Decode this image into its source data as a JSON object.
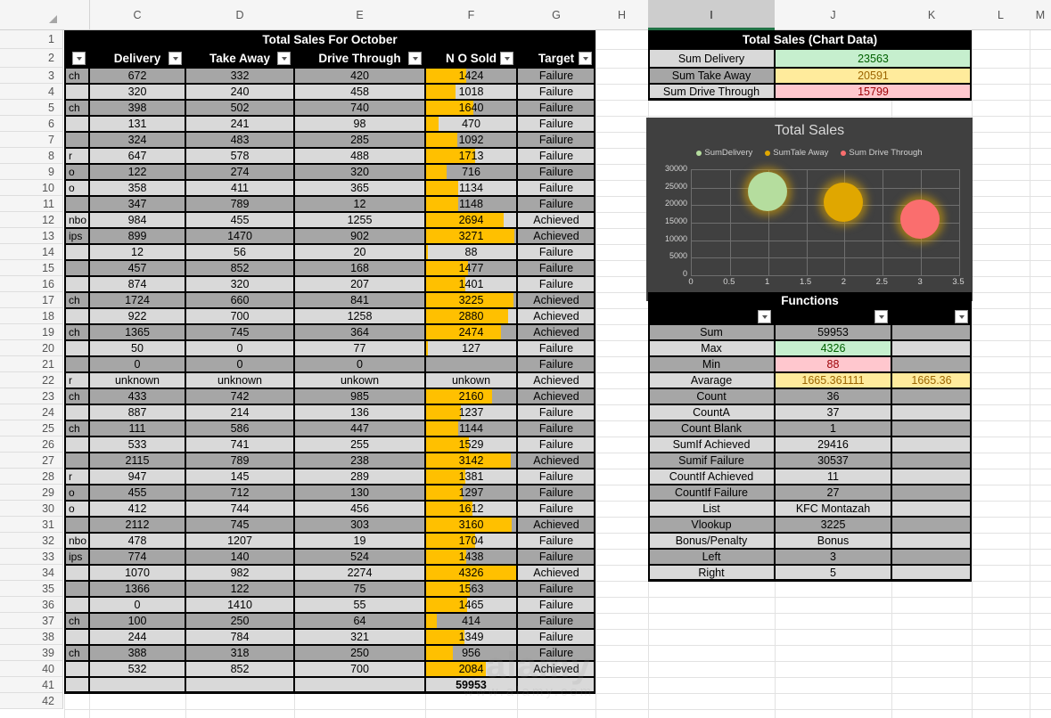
{
  "sheet": {
    "column_headers": [
      "C",
      "D",
      "E",
      "F",
      "G",
      "H",
      "I",
      "J",
      "K",
      "L",
      "M"
    ],
    "row_numbers": [
      1,
      2,
      3,
      4,
      5,
      6,
      7,
      8,
      9,
      10,
      11,
      12,
      13,
      14,
      15,
      16,
      17,
      18,
      19,
      20,
      21,
      22,
      23,
      24,
      25,
      26,
      27,
      28,
      29,
      30,
      31,
      32,
      33,
      34,
      35,
      36,
      37,
      38,
      39,
      40,
      41,
      42
    ],
    "selected_column": "I",
    "select_all_icon": "select-all-triangle-icon",
    "filter_icon": "filter-dropdown-icon"
  },
  "sales_table": {
    "title": "Total Sales For October",
    "headers": [
      "",
      "Delivery",
      "Take Away",
      "Drive Through",
      "N O Sold",
      "Target"
    ],
    "rows": [
      {
        "b": "ch",
        "delivery": "672",
        "takeaway": "332",
        "drive": "420",
        "sold": "1424",
        "bar": 45,
        "target": "Failure"
      },
      {
        "b": "",
        "delivery": "320",
        "takeaway": "240",
        "drive": "458",
        "sold": "1018",
        "bar": 33,
        "target": "Failure"
      },
      {
        "b": "ch",
        "delivery": "398",
        "takeaway": "502",
        "drive": "740",
        "sold": "1640",
        "bar": 52,
        "target": "Failure"
      },
      {
        "b": "",
        "delivery": "131",
        "takeaway": "241",
        "drive": "98",
        "sold": "470",
        "bar": 15,
        "target": "Failure"
      },
      {
        "b": "",
        "delivery": "324",
        "takeaway": "483",
        "drive": "285",
        "sold": "1092",
        "bar": 35,
        "target": "Failure"
      },
      {
        "b": "r",
        "delivery": "647",
        "takeaway": "578",
        "drive": "488",
        "sold": "1713",
        "bar": 54,
        "target": "Failure"
      },
      {
        "b": "o",
        "delivery": "122",
        "takeaway": "274",
        "drive": "320",
        "sold": "716",
        "bar": 23,
        "target": "Failure"
      },
      {
        "b": "o",
        "delivery": "358",
        "takeaway": "411",
        "drive": "365",
        "sold": "1134",
        "bar": 36,
        "target": "Failure"
      },
      {
        "b": "",
        "delivery": "347",
        "takeaway": "789",
        "drive": "12",
        "sold": "1148",
        "bar": 36,
        "target": "Failure"
      },
      {
        "b": "nbo",
        "delivery": "984",
        "takeaway": "455",
        "drive": "1255",
        "sold": "2694",
        "bar": 85,
        "target": "Achieved"
      },
      {
        "b": "ips",
        "delivery": "899",
        "takeaway": "1470",
        "drive": "902",
        "sold": "3271",
        "bar": 97,
        "target": "Achieved"
      },
      {
        "b": "",
        "delivery": "12",
        "takeaway": "56",
        "drive": "20",
        "sold": "88",
        "bar": 3,
        "target": "Failure"
      },
      {
        "b": "",
        "delivery": "457",
        "takeaway": "852",
        "drive": "168",
        "sold": "1477",
        "bar": 47,
        "target": "Failure"
      },
      {
        "b": "",
        "delivery": "874",
        "takeaway": "320",
        "drive": "207",
        "sold": "1401",
        "bar": 44,
        "target": "Failure"
      },
      {
        "b": "ch",
        "delivery": "1724",
        "takeaway": "660",
        "drive": "841",
        "sold": "3225",
        "bar": 96,
        "target": "Achieved"
      },
      {
        "b": "",
        "delivery": "922",
        "takeaway": "700",
        "drive": "1258",
        "sold": "2880",
        "bar": 90,
        "target": "Achieved"
      },
      {
        "b": "ch",
        "delivery": "1365",
        "takeaway": "745",
        "drive": "364",
        "sold": "2474",
        "bar": 83,
        "target": "Achieved"
      },
      {
        "b": "",
        "delivery": "50",
        "takeaway": "0",
        "drive": "77",
        "sold": "127",
        "bar": 3,
        "target": "Failure"
      },
      {
        "b": "",
        "delivery": "0",
        "takeaway": "0",
        "drive": "0",
        "sold": "",
        "bar": 0,
        "target": "Failure"
      },
      {
        "b": "r",
        "delivery": "unknown",
        "takeaway": "unknown",
        "drive": "unkown",
        "sold": "unkown",
        "bar": 0,
        "target": "Achieved"
      },
      {
        "b": "ch",
        "delivery": "433",
        "takeaway": "742",
        "drive": "985",
        "sold": "2160",
        "bar": 73,
        "target": "Achieved"
      },
      {
        "b": "",
        "delivery": "887",
        "takeaway": "214",
        "drive": "136",
        "sold": "1237",
        "bar": 39,
        "target": "Failure"
      },
      {
        "b": "ch",
        "delivery": "111",
        "takeaway": "586",
        "drive": "447",
        "sold": "1144",
        "bar": 36,
        "target": "Failure"
      },
      {
        "b": "",
        "delivery": "533",
        "takeaway": "741",
        "drive": "255",
        "sold": "1529",
        "bar": 48,
        "target": "Failure"
      },
      {
        "b": "",
        "delivery": "2115",
        "takeaway": "789",
        "drive": "238",
        "sold": "3142",
        "bar": 93,
        "target": "Achieved"
      },
      {
        "b": "r",
        "delivery": "947",
        "takeaway": "145",
        "drive": "289",
        "sold": "1381",
        "bar": 44,
        "target": "Failure"
      },
      {
        "b": "o",
        "delivery": "455",
        "takeaway": "712",
        "drive": "130",
        "sold": "1297",
        "bar": 41,
        "target": "Failure"
      },
      {
        "b": "o",
        "delivery": "412",
        "takeaway": "744",
        "drive": "456",
        "sold": "1612",
        "bar": 51,
        "target": "Failure"
      },
      {
        "b": "",
        "delivery": "2112",
        "takeaway": "745",
        "drive": "303",
        "sold": "3160",
        "bar": 94,
        "target": "Achieved"
      },
      {
        "b": "nbo",
        "delivery": "478",
        "takeaway": "1207",
        "drive": "19",
        "sold": "1704",
        "bar": 54,
        "target": "Failure"
      },
      {
        "b": "ips",
        "delivery": "774",
        "takeaway": "140",
        "drive": "524",
        "sold": "1438",
        "bar": 45,
        "target": "Failure"
      },
      {
        "b": "",
        "delivery": "1070",
        "takeaway": "982",
        "drive": "2274",
        "sold": "4326",
        "bar": 100,
        "target": "Achieved"
      },
      {
        "b": "",
        "delivery": "1366",
        "takeaway": "122",
        "drive": "75",
        "sold": "1563",
        "bar": 49,
        "target": "Failure"
      },
      {
        "b": "",
        "delivery": "0",
        "takeaway": "1410",
        "drive": "55",
        "sold": "1465",
        "bar": 46,
        "target": "Failure"
      },
      {
        "b": "ch",
        "delivery": "100",
        "takeaway": "250",
        "drive": "64",
        "sold": "414",
        "bar": 13,
        "target": "Failure"
      },
      {
        "b": "",
        "delivery": "244",
        "takeaway": "784",
        "drive": "321",
        "sold": "1349",
        "bar": 43,
        "target": "Failure"
      },
      {
        "b": "ch",
        "delivery": "388",
        "takeaway": "318",
        "drive": "250",
        "sold": "956",
        "bar": 30,
        "target": "Failure"
      },
      {
        "b": "",
        "delivery": "532",
        "takeaway": "852",
        "drive": "700",
        "sold": "2084",
        "bar": 66,
        "target": "Achieved"
      }
    ],
    "total_row": {
      "delivery": "",
      "takeaway": "",
      "drive": "",
      "sold": "59953",
      "target": ""
    }
  },
  "chart_data_table": {
    "title": "Total Sales (Chart Data)",
    "rows": [
      {
        "label": "Sum Delivery",
        "value": "23563",
        "fill": "#c6efce",
        "text": "#006100"
      },
      {
        "label": "Sum Take Away",
        "value": "20591",
        "fill": "#ffeb9c",
        "text": "#9c6500"
      },
      {
        "label": "Sum  Drive Through",
        "value": "15799",
        "fill": "#ffc7ce",
        "text": "#9c0006"
      }
    ]
  },
  "chart_data": {
    "type": "scatter",
    "title": "Total Sales",
    "legend": [
      "SumDelivery",
      "SumTale Away",
      "Sum Drive Through"
    ],
    "legend_position": "top",
    "series": [
      {
        "name": "SumDelivery",
        "x": 1,
        "y": 23563,
        "color": "#b5dd9e"
      },
      {
        "name": "SumTale Away",
        "x": 2,
        "y": 20591,
        "color": "#e0a700"
      },
      {
        "name": "Sum Drive Through",
        "x": 3,
        "y": 15799,
        "color": "#fa6e6e"
      }
    ],
    "xticks": [
      "0",
      "0.5",
      "1",
      "1.5",
      "2",
      "2.5",
      "3",
      "3.5"
    ],
    "yticks": [
      "0",
      "5000",
      "10000",
      "15000",
      "20000",
      "25000",
      "30000"
    ],
    "xlim": [
      0,
      3.5
    ],
    "ylim": [
      0,
      30000
    ],
    "xlabel": "",
    "ylabel": "",
    "grid": true,
    "background": "#404040"
  },
  "functions_table": {
    "title": "Functions",
    "rows": [
      {
        "label": "Sum",
        "value": "59953",
        "extra": "",
        "vfill": "",
        "vtext": ""
      },
      {
        "label": "Max",
        "value": "4326",
        "extra": "",
        "vfill": "#c6efce",
        "vtext": "#006100"
      },
      {
        "label": "Min",
        "value": "88",
        "extra": "",
        "vfill": "#ffc7ce",
        "vtext": "#9c0006"
      },
      {
        "label": "Avarage",
        "value": "1665.361111",
        "extra": "1665.36",
        "vfill": "#ffeb9c",
        "vtext": "#9c6500"
      },
      {
        "label": "Count",
        "value": "36",
        "extra": "",
        "vfill": "",
        "vtext": ""
      },
      {
        "label": "CountA",
        "value": "37",
        "extra": "",
        "vfill": "",
        "vtext": ""
      },
      {
        "label": "Count Blank",
        "value": "1",
        "extra": "",
        "vfill": "",
        "vtext": ""
      },
      {
        "label": "SumIf Achieved",
        "value": "29416",
        "extra": "",
        "vfill": "",
        "vtext": ""
      },
      {
        "label": "Sumif Failure",
        "value": "30537",
        "extra": "",
        "vfill": "",
        "vtext": ""
      },
      {
        "label": "CountIf Achieved",
        "value": "11",
        "extra": "",
        "vfill": "",
        "vtext": ""
      },
      {
        "label": "CountIf Failure",
        "value": "27",
        "extra": "",
        "vfill": "",
        "vtext": ""
      },
      {
        "label": "List",
        "value": "KFC Montazah",
        "extra": "",
        "vfill": "",
        "vtext": ""
      },
      {
        "label": "Vlookup",
        "value": "3225",
        "extra": "",
        "vfill": "",
        "vtext": ""
      },
      {
        "label": "Bonus/Penalty",
        "value": "Bonus",
        "extra": "",
        "vfill": "",
        "vtext": ""
      },
      {
        "label": "Left",
        "value": "3",
        "extra": "",
        "vfill": "",
        "vtext": ""
      },
      {
        "label": "Right",
        "value": "5",
        "extra": "",
        "vfill": "",
        "vtext": ""
      }
    ]
  },
  "watermark": {
    "line1": "alamy",
    "line2": "www.alamy.com"
  }
}
